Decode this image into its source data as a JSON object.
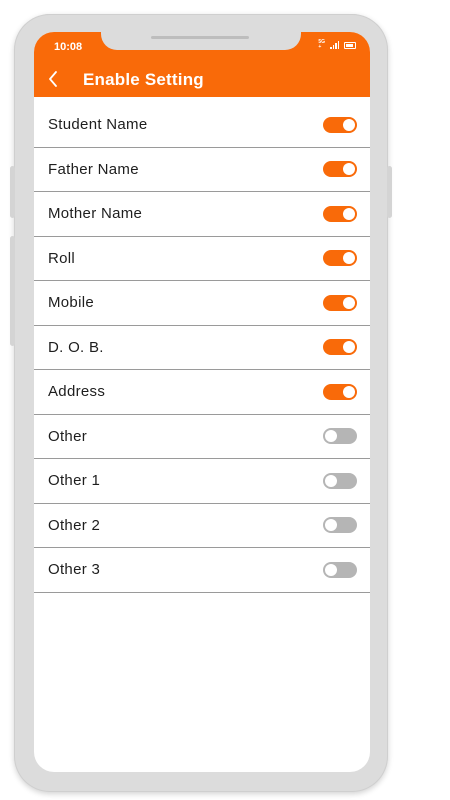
{
  "status_bar": {
    "time": "10:08",
    "network": "5G"
  },
  "header": {
    "title": "Enable Setting",
    "back_icon": "chevron-left-icon"
  },
  "colors": {
    "accent": "#f96a09",
    "toggle_off": "#b5b5b5",
    "divider": "#9a9a9a"
  },
  "settings": [
    {
      "label": "Student Name",
      "enabled": true
    },
    {
      "label": "Father Name",
      "enabled": true
    },
    {
      "label": "Mother Name",
      "enabled": true
    },
    {
      "label": "Roll",
      "enabled": true
    },
    {
      "label": "Mobile",
      "enabled": true
    },
    {
      "label": "D. O. B.",
      "enabled": true
    },
    {
      "label": "Address",
      "enabled": true
    },
    {
      "label": "Other",
      "enabled": false
    },
    {
      "label": "Other 1",
      "enabled": false
    },
    {
      "label": "Other 2",
      "enabled": false
    },
    {
      "label": "Other 3",
      "enabled": false
    }
  ]
}
